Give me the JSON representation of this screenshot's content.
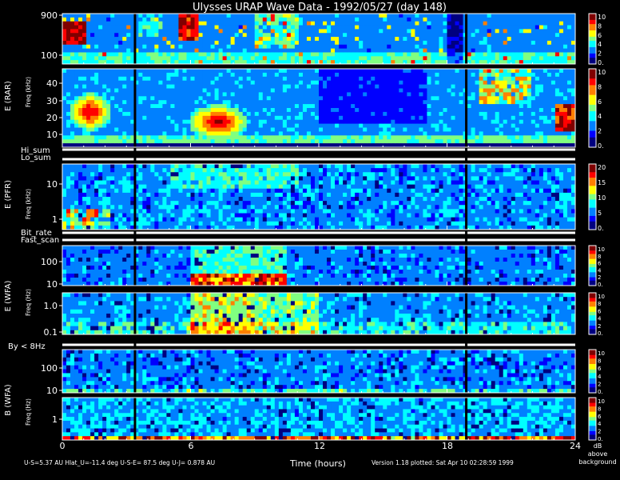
{
  "chart_data": {
    "type": "heatmap",
    "title": "Ulysses URAP Wave Data - 1992/05/27  (day 148)",
    "xlabel": "Time (hours)",
    "x_ticks": [
      "0",
      "6",
      "12",
      "18",
      "24"
    ],
    "xlim": [
      0,
      24
    ],
    "colorbar_unit": [
      "dB",
      "above",
      "background"
    ],
    "footer_left": "U-S=5.37 AU  Hlat_U=-11.4 deg  U-S-E= 87.5 deg  U-J= 0.878 AU",
    "footer_right": "Version 1.18 plotted: Sat Apr 10 02:28:59 1999",
    "strips": [
      "Hi_sum",
      "Lo_sum",
      "Bit_rate",
      "Fast_scan",
      "By < 8Hz"
    ],
    "panels": [
      {
        "id": "rar-high",
        "group": "E (RAR)",
        "ylabel": "",
        "yticks": [
          "900",
          "100"
        ],
        "colorbar": [
          "10",
          "8",
          "6",
          "4",
          "2",
          "0."
        ],
        "log_scale": true
      },
      {
        "id": "rar-low",
        "group": "E (RAR)",
        "ylabel": "Freq (kHz)",
        "yticks": [
          "40",
          "30",
          "20",
          "10"
        ],
        "colorbar": [
          "10",
          "8",
          "6",
          "4",
          "2",
          "0."
        ],
        "log_scale": false
      },
      {
        "id": "pfr",
        "group": "E (PFR)",
        "ylabel": "Freq (kHz)",
        "yticks": [
          "10",
          "1"
        ],
        "colorbar": [
          "20",
          "15",
          "10",
          "5",
          "0."
        ],
        "log_scale": true
      },
      {
        "id": "wfa-e-high",
        "group": "E (WFA)",
        "ylabel": "",
        "yticks": [
          "100",
          "10"
        ],
        "colorbar": [
          "10",
          "8",
          "6",
          "4",
          "2",
          "0."
        ],
        "log_scale": true
      },
      {
        "id": "wfa-e-low",
        "group": "E (WFA)",
        "ylabel": "Freq (Hz)",
        "yticks": [
          "1.0",
          "0.1"
        ],
        "colorbar": [
          "10",
          "8",
          "6",
          "4",
          "2",
          "0."
        ],
        "log_scale": true
      },
      {
        "id": "wfa-b-high",
        "group": "B (WFA)",
        "ylabel": "",
        "yticks": [
          "100",
          "10"
        ],
        "colorbar": [
          "10",
          "8",
          "6",
          "4",
          "2",
          "0."
        ],
        "log_scale": true
      },
      {
        "id": "wfa-b-low",
        "group": "B (WFA)",
        "ylabel": "Freq (Hz)",
        "yticks": [
          "1"
        ],
        "colorbar": [
          "10",
          "8",
          "6",
          "4",
          "2",
          "0."
        ],
        "log_scale": true
      }
    ],
    "data_gaps_hours": [
      3.4,
      18.9
    ],
    "colormap": [
      "#000080",
      "#0000ff",
      "#0080ff",
      "#00ffff",
      "#80ff80",
      "#ffff00",
      "#ff8000",
      "#ff0000",
      "#800000"
    ]
  }
}
